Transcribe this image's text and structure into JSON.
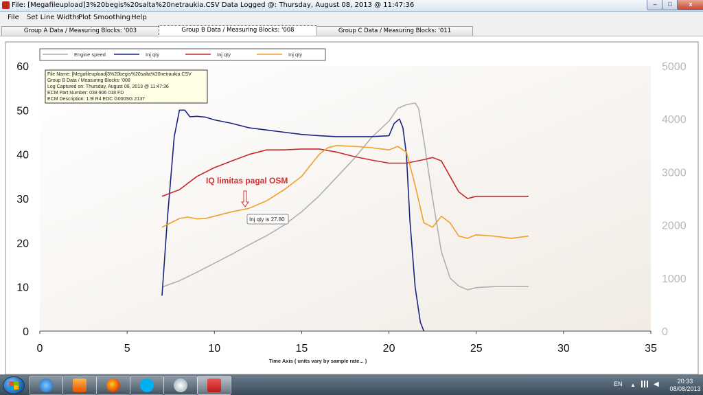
{
  "window": {
    "title": "File: [Megafileupload]3%20begis%20salta%20netraukia.CSV Data Logged @: Thursday, August 08, 2013 @ 11:47:36",
    "minimize": "–",
    "maximize": "□",
    "close": "x"
  },
  "menu": [
    "File",
    "Set Line Widths",
    "Plot Smoothing",
    "Help"
  ],
  "tabs": [
    {
      "label": "Group A Data / Measuring Blocks: '003",
      "active": false
    },
    {
      "label": "Group B Data / Measuring Blocks: '008",
      "active": true
    },
    {
      "label": "Group C Data / Measuring Blocks: '011",
      "active": false
    }
  ],
  "legend": [
    {
      "name": "Engine speed",
      "color": "#b0b0b0"
    },
    {
      "name": "Inj qty",
      "color": "#1a237e"
    },
    {
      "name": "Inj qty",
      "color": "#c62828"
    },
    {
      "name": "Inj qty",
      "color": "#f29d2c"
    }
  ],
  "info_box": [
    "File Name: [Megafileupload]3%20begis%20salta%20netraukia.CSV",
    "Group B Data / Measuring Blocks: '008",
    "Log Captured on: Thursday, August 08, 2013 @ 11:47:36",
    "ECM Part Number: 038 906 018 FD",
    "ECM Description: 1.9l R4 EDC G000SG  2137"
  ],
  "annotation": "IQ limitas pagal OSM",
  "tooltip": "Inj qty is 27.80",
  "chart_data": {
    "type": "line",
    "title": "",
    "xlabel": "Time Axis ( units vary by sample rate... )",
    "ylabel": "",
    "xlim": [
      0,
      35
    ],
    "ylim": [
      0,
      60
    ],
    "y2lim": [
      0,
      5000
    ],
    "x_ticks": [
      0,
      5,
      10,
      15,
      20,
      25,
      30,
      35
    ],
    "y_ticks": [
      0,
      10,
      20,
      30,
      40,
      50,
      60
    ],
    "y2_ticks": [
      0,
      1000,
      2000,
      3000,
      4000,
      5000
    ],
    "grid": false,
    "legend_position": "top-left",
    "series": [
      {
        "name": "Engine speed",
        "axis": "right",
        "color": "#b0b0b0",
        "x": [
          7,
          8,
          9,
          10,
          11,
          12,
          13,
          14,
          15,
          16,
          17,
          18,
          19,
          20,
          20.5,
          21,
          21.5,
          21.7,
          22,
          22.5,
          23,
          23.5,
          24,
          24.5,
          25,
          26,
          27,
          28
        ],
        "y": [
          830,
          950,
          1110,
          1280,
          1450,
          1630,
          1800,
          2000,
          2250,
          2550,
          2900,
          3250,
          3650,
          3960,
          4200,
          4270,
          4300,
          4200,
          3600,
          2500,
          1500,
          1000,
          850,
          780,
          820,
          840,
          840,
          840
        ]
      },
      {
        "name": "Inj qty",
        "axis": "left",
        "color": "#1a237e",
        "x": [
          7,
          7.3,
          7.7,
          8,
          8.3,
          8.6,
          9,
          9.5,
          10,
          11,
          12,
          13,
          14,
          15,
          16,
          17,
          18,
          19,
          20,
          20.3,
          20.6,
          20.8,
          21,
          21.2,
          21.5,
          21.8,
          22
        ],
        "y": [
          8,
          25,
          44,
          50,
          50,
          48.5,
          48.6,
          48.4,
          47.8,
          47,
          46,
          45.5,
          45,
          44.5,
          44.2,
          44,
          44,
          44,
          44.2,
          47,
          48,
          46,
          40,
          25,
          10,
          2,
          0
        ]
      },
      {
        "name": "Inj qty",
        "axis": "left",
        "color": "#c62828",
        "x": [
          7,
          8,
          9,
          10,
          11,
          12,
          13,
          14,
          15,
          16,
          17,
          18,
          19,
          20,
          21,
          22,
          22.5,
          23,
          23.5,
          24,
          24.5,
          25,
          26,
          27,
          28
        ],
        "y": [
          30.5,
          32,
          35,
          37,
          38.5,
          40,
          41,
          41,
          41.2,
          41.2,
          40.5,
          39.5,
          38.7,
          38,
          38,
          38.8,
          39.3,
          38.5,
          35,
          31.5,
          30,
          30.5,
          30.5,
          30.5,
          30.5
        ]
      },
      {
        "name": "Inj qty",
        "axis": "left",
        "color": "#f29d2c",
        "x": [
          7,
          7.5,
          8,
          8.5,
          9,
          9.5,
          10,
          11,
          12,
          13,
          14,
          15,
          16,
          16.5,
          17,
          18,
          19,
          20,
          20.5,
          21,
          21.5,
          22,
          22.5,
          23,
          23.5,
          24,
          24.5,
          25,
          26,
          27,
          28
        ],
        "y": [
          23.5,
          24.5,
          25.5,
          25.8,
          25.4,
          25.5,
          26,
          27,
          27.8,
          29.5,
          32,
          35,
          40,
          41.5,
          42,
          41.8,
          41.5,
          41,
          41.8,
          40.5,
          33,
          24.5,
          23.5,
          26,
          24.5,
          21.5,
          21,
          21.8,
          21.5,
          21,
          21.5
        ]
      }
    ]
  },
  "taskbar": {
    "apps": [
      "windows-explorer",
      "internet-explorer",
      "media-player",
      "firefox",
      "skype",
      "paint",
      "vcds-scan"
    ],
    "language": "EN",
    "time": "20:33",
    "date": "08/08/2013"
  }
}
